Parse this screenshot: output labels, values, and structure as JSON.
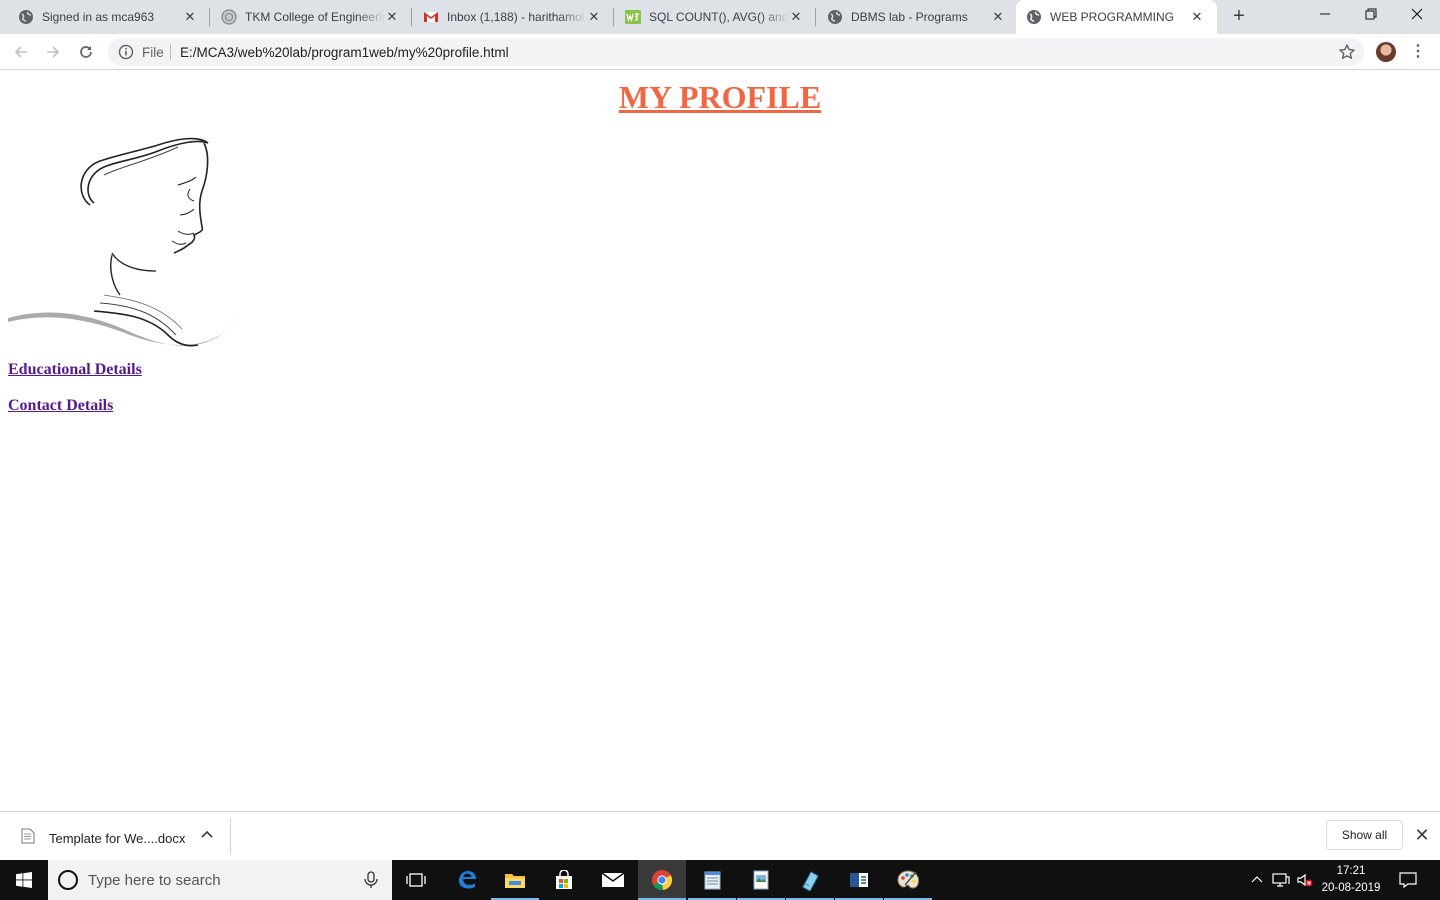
{
  "browser": {
    "tabs": [
      {
        "title": "Signed in as mca963",
        "favicon": "globe-icon",
        "active": false
      },
      {
        "title": "TKM College of Engineering",
        "favicon": "college-seal-icon",
        "active": false
      },
      {
        "title": "Inbox (1,188) - harithamol",
        "favicon": "gmail-icon",
        "active": false
      },
      {
        "title": "SQL COUNT(), AVG() and SUM()",
        "favicon": "w3schools-icon",
        "active": false
      },
      {
        "title": "DBMS lab - Programs",
        "favicon": "globe-icon",
        "active": false
      },
      {
        "title": "WEB PROGRAMMING",
        "favicon": "globe-icon",
        "active": true
      }
    ],
    "new_tab": "+",
    "address": {
      "scheme_label": "File",
      "url": "E:/MCA3/web%20lab/program1web/my%20profile.html"
    }
  },
  "page": {
    "heading": "MY PROFILE",
    "links": [
      "Educational Details",
      "Contact Details"
    ]
  },
  "download_shelf": {
    "file_name": "Template for We....docx",
    "show_all": "Show all"
  },
  "taskbar": {
    "search_placeholder": "Type here to search",
    "time": "17:21",
    "date": "20-08-2019"
  },
  "colors": {
    "heading": "#f26743",
    "visited_link": "#551a8b",
    "tabstrip": "#dee1e6",
    "taskbar": "#101010"
  }
}
